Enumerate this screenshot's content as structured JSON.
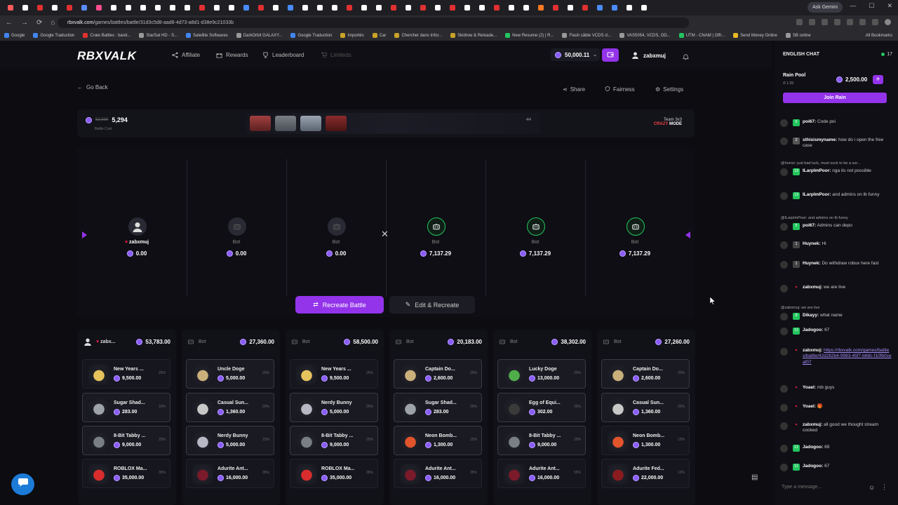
{
  "browser": {
    "gemini_label": "Ask Gemini",
    "url_host": "rbxvalk.com",
    "url_path": "/games/battles/battle/31d3c5d8-aad6-4d73-a8d1-d38e9c21033b",
    "bookmarks": [
      "Google",
      "Google Traduction",
      "Crate Battles : band...",
      "StarSat HD - S...",
      "Satellite Softwares",
      "DarkOrbit GALAXY...",
      "Google Traduction",
      "Importés",
      "Car",
      "Chercher dans Infor...",
      "Skidrow & Reloade...",
      "New Resume (2) | R...",
      "Flash câble VCDS cl...",
      "VAS5054, VCDS, OD...",
      "UTM - CNAM | Offr...",
      "Send Money Online",
      "SB online"
    ],
    "all_bookmarks": "All Bookmarks"
  },
  "header": {
    "logo": "RBXVALK",
    "nav": [
      "Affiliate",
      "Rewards",
      "Leaderboard",
      "Limiteds"
    ],
    "balance": "50,000.11",
    "username": "zabxmuj"
  },
  "battle": {
    "go_back": "Go Back",
    "share": "Share",
    "fairness": "Fairness",
    "settings": "Settings",
    "old_cost": "52,939",
    "cost": "5,294",
    "cost_label": "Battle Cost",
    "round_counter": "4/4",
    "team_label": "Team 3v3",
    "mode_accent": "CRAZY",
    "mode_rest": "MODE",
    "recreate_label": "Recreate Battle",
    "edit_recreate_label": "Edit & Recreate",
    "players": [
      {
        "name": "zabxmuj",
        "value": "0.00",
        "winner": false
      },
      {
        "name": "Bot",
        "value": "0.00",
        "winner": false
      },
      {
        "name": "Bot",
        "value": "0.00",
        "winner": false
      },
      {
        "name": "Bot",
        "value": "7,137.29",
        "winner": true
      },
      {
        "name": "Bot",
        "value": "7,137.29",
        "winner": true
      },
      {
        "name": "Bot",
        "value": "7,137.29",
        "winner": true
      }
    ],
    "columns": [
      {
        "name": "zabx...",
        "total": "53,783.00",
        "items": [
          {
            "name": "New Years ...",
            "price": "9,500.00",
            "pct": "25%",
            "color": "#e6c35c"
          },
          {
            "name": "Sugar Shad...",
            "price": "283.00",
            "pct": "20%",
            "color": "#9ea3aa"
          },
          {
            "name": "8-Bit Tabby ...",
            "price": "9,000.00",
            "pct": "25%",
            "color": "#7a7f86"
          },
          {
            "name": "ROBLOX Ma...",
            "price": "35,000.00",
            "pct": "35%",
            "color": "#d92c2c"
          }
        ]
      },
      {
        "name": "Bot",
        "total": "27,360.00",
        "items": [
          {
            "name": "Uncle Doge",
            "price": "5,000.00",
            "pct": "20%",
            "color": "#c9b07a"
          },
          {
            "name": "Casual Sun...",
            "price": "1,360.00",
            "pct": "20%",
            "color": "#c8c8c8"
          },
          {
            "name": "Nerdy Bunny",
            "price": "5,000.00",
            "pct": "15%",
            "color": "#b8b8c4"
          },
          {
            "name": "Adurite Ant...",
            "price": "16,000.00",
            "pct": "35%",
            "color": "#7a1a2a"
          }
        ]
      },
      {
        "name": "Bot",
        "total": "58,500.00",
        "items": [
          {
            "name": "New Years ...",
            "price": "9,500.00",
            "pct": "25%",
            "color": "#e6c35c"
          },
          {
            "name": "Nerdy Bunny",
            "price": "5,000.00",
            "pct": "20%",
            "color": "#b8b8c4"
          },
          {
            "name": "8-Bit Tabby ...",
            "price": "9,000.00",
            "pct": "20%",
            "color": "#7a7f86"
          },
          {
            "name": "ROBLOX Ma...",
            "price": "35,000.00",
            "pct": "35%",
            "color": "#d92c2c"
          }
        ]
      },
      {
        "name": "Bot",
        "total": "20,183.00",
        "items": [
          {
            "name": "Captain Do...",
            "price": "2,600.00",
            "pct": "20%",
            "color": "#c9b07a"
          },
          {
            "name": "Sugar Shad...",
            "price": "283.00",
            "pct": "20%",
            "color": "#9ea3aa"
          },
          {
            "name": "Neon Bomb...",
            "price": "1,300.00",
            "pct": "15%",
            "color": "#e2542b"
          },
          {
            "name": "Adurite Ant...",
            "price": "16,000.00",
            "pct": "35%",
            "color": "#7a1a2a"
          }
        ]
      },
      {
        "name": "Bot",
        "total": "38,302.00",
        "items": [
          {
            "name": "Lucky Doge",
            "price": "13,000.00",
            "pct": "20%",
            "color": "#4fae4a"
          },
          {
            "name": "Egg of Equi...",
            "price": "302.00",
            "pct": "20%",
            "color": "#3a3a3a"
          },
          {
            "name": "8-Bit Tabby ...",
            "price": "9,000.00",
            "pct": "20%",
            "color": "#7a7f86"
          },
          {
            "name": "Adurite Ant...",
            "price": "16,000.00",
            "pct": "55%",
            "color": "#7a1a2a"
          }
        ]
      },
      {
        "name": "Bot",
        "total": "27,260.00",
        "items": [
          {
            "name": "Captain Do...",
            "price": "2,600.00",
            "pct": "20%",
            "color": "#c9b07a"
          },
          {
            "name": "Casual Sun...",
            "price": "1,360.00",
            "pct": "20%",
            "color": "#c8c8c8"
          },
          {
            "name": "Neon Bomb...",
            "price": "1,300.00",
            "pct": "15%",
            "color": "#e2542b"
          },
          {
            "name": "Adurite Fed...",
            "price": "22,000.00",
            "pct": "10%",
            "color": "#8a1c20"
          }
        ]
      }
    ]
  },
  "chat": {
    "title": "ENGLISH CHAT",
    "online": "17",
    "rain_title": "Rain Pool",
    "rain_time": "1:39",
    "rain_amount": "2,500.00",
    "join_rain": "Join Rain",
    "input_placeholder": "Type a message...",
    "messages": [
      {
        "reply": "",
        "level": "5",
        "user": "poi67:",
        "text": "Code poi"
      },
      {
        "reply": "",
        "level": "2",
        "user": "sthisismyname:",
        "text": "how do i open the free case"
      },
      {
        "reply": "@horror: just bad luck, must suck to be a sor...",
        "level": "13",
        "user": "ILarpImPoor:",
        "text": "nga its not possible"
      },
      {
        "reply": "",
        "level": "13",
        "user": "ILarpImPoor:",
        "text": "and admins on lb funny"
      },
      {
        "reply": "@ILarpImPoor: and admins on lb funny",
        "level": "5",
        "user": "poi67:",
        "text": "Admins can depo"
      },
      {
        "reply": "",
        "level": "1",
        "user": "Huynek:",
        "text": "Hi"
      },
      {
        "reply": "",
        "level": "1",
        "user": "Huynek:",
        "text": "Do withdraw robux here fast"
      },
      {
        "reply": "",
        "level": "",
        "user": "zabxmuj:",
        "text": "we are live"
      },
      {
        "reply": "@zabxmuj: we are live",
        "level": "8",
        "user": "Dikayy:",
        "text": "what name"
      },
      {
        "reply": "",
        "level": "11",
        "user": "Jadogoo:",
        "text": "67"
      },
      {
        "reply": "",
        "level": "",
        "user": "zabxmuj:",
        "text": "https://rbxvalk.com/games/battles/battle/42d282b4-9983-45f7-b68c-f10fb0ceaf07"
      },
      {
        "reply": "",
        "level": "",
        "user": "Yoael:",
        "text": "mb guys"
      },
      {
        "reply": "",
        "level": "",
        "user": "Yoael:",
        "text": "🎁"
      },
      {
        "reply": "",
        "level": "",
        "user": "zabxmuj:",
        "text": "all good we thought stream cooked"
      },
      {
        "reply": "",
        "level": "11",
        "user": "Jadogoo:",
        "text": "69"
      },
      {
        "reply": "",
        "level": "11",
        "user": "Jadogoo:",
        "text": "67"
      }
    ]
  },
  "colors": {
    "accent": "#9333ea",
    "win": "#22c55e",
    "bg": "#0c0c11"
  }
}
